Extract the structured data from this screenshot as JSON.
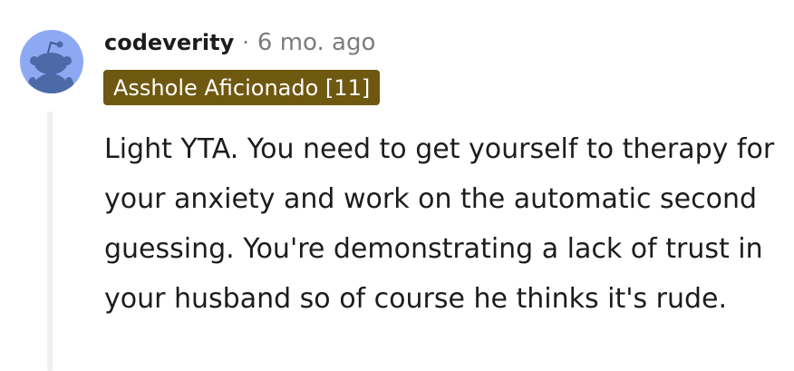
{
  "comment": {
    "author": "codeverity",
    "separator": "·",
    "timestamp": "6 mo. ago",
    "flair": "Asshole Aficionado [11]",
    "body": "Light YTA. You need to get yourself to therapy for your anxiety and work on the automatic second guessing. You're demonstrating a lack of trust in your husband so of course he thinks it's rude."
  },
  "avatar": {
    "icon": "snoo-avatar-icon",
    "background_color": "#8ea9f4"
  },
  "colors": {
    "flair_background": "#6f5810",
    "flair_text": "#ffffff",
    "meta_gray": "#7c7c7c",
    "text": "#1c1c1c",
    "thread_line": "#edeff1"
  }
}
